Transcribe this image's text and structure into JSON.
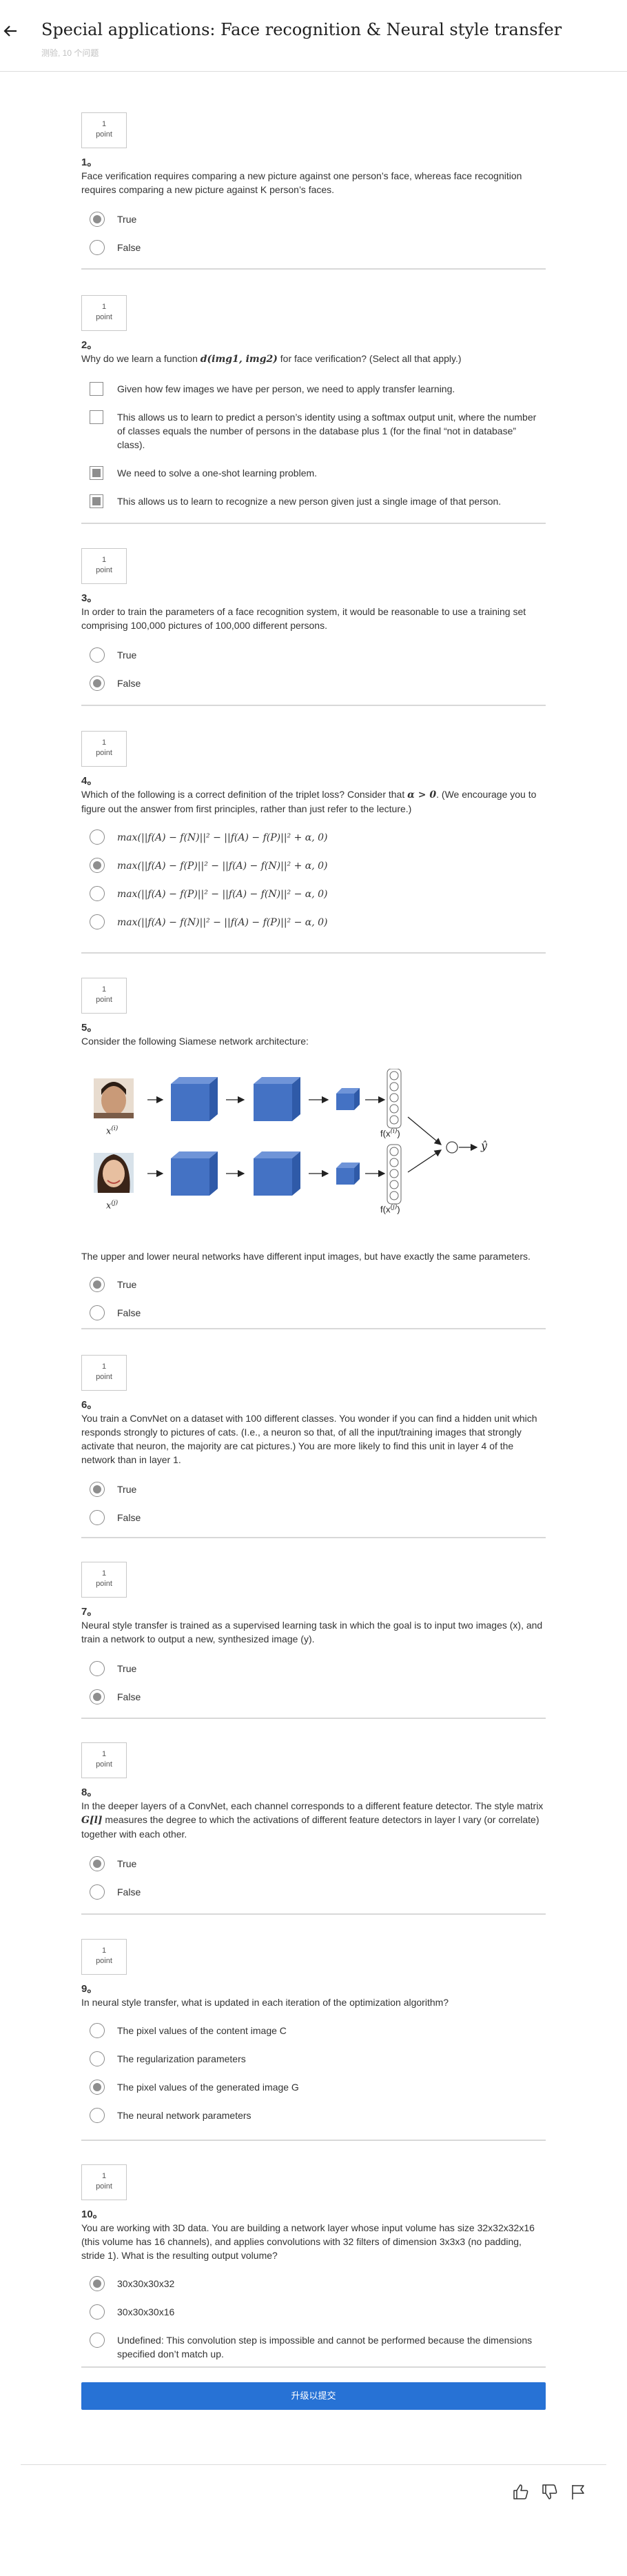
{
  "header": {
    "title": "Special applications: Face recognition & Neural style transfer",
    "subtitle": "测验, 10 个问题"
  },
  "point_label": "point",
  "point_value": "1",
  "questions": [
    {
      "num": "1。",
      "text": "Face verification requires comparing a new picture against one person’s face, whereas face recognition requires comparing a new picture against K person’s faces.",
      "options": [
        {
          "label": "True",
          "selected": true
        },
        {
          "label": "False",
          "selected": false
        }
      ]
    },
    {
      "num": "2。",
      "text_before": "Why do we learn a function ",
      "text_math": "d(img1, img2)",
      "text_after": " for face verification? (Select all that apply.)",
      "options": [
        {
          "label": "Given how few images we have per person, we need to apply transfer learning.",
          "selected": false
        },
        {
          "label": "This allows us to learn to predict a person’s identity using a softmax output unit, where the number of classes equals the number of persons in the database plus 1 (for the final “not in database” class).",
          "selected": false
        },
        {
          "label": "We need to solve a one-shot learning problem.",
          "selected": true
        },
        {
          "label": "This allows us to learn to recognize a new person given just a single image of that person.",
          "selected": true
        }
      ]
    },
    {
      "num": "3。",
      "text": "In order to train the parameters of a face recognition system, it would be reasonable to use a training set comprising 100,000 pictures of 100,000 different persons.",
      "options": [
        {
          "label": "True",
          "selected": false
        },
        {
          "label": "False",
          "selected": true
        }
      ]
    },
    {
      "num": "4。",
      "text_before": "Which of the following is a correct definition of the triplet loss? Consider that ",
      "text_math": "α > 0",
      "text_after": ". (We encourage you to figure out the answer from first principles, rather than just refer to the lecture.)",
      "options": [
        {
          "label": "max(||f(A) − f(N)||² − ||f(A) − f(P)||² + α, 0)",
          "selected": false
        },
        {
          "label": "max(||f(A) − f(P)||² − ||f(A) − f(N)||² + α, 0)",
          "selected": true
        },
        {
          "label": "max(||f(A) − f(P)||² − ||f(A) − f(N)||² − α, 0)",
          "selected": false
        },
        {
          "label": "max(||f(A) − f(N)||² − ||f(A) − f(P)||² − α, 0)",
          "selected": false
        }
      ]
    },
    {
      "num": "5。",
      "text": "Consider the following Siamese network architecture:",
      "figure": {
        "x_top": "x",
        "x_top_sup": "(i)",
        "x_bottom": "x",
        "x_bottom_sup": "(j)",
        "f_top": "f(x",
        "f_top_sup": "(i)",
        "f_bottom": "f(x",
        "f_bottom_sup": "(j)",
        "y_hat": "ŷ",
        "cube_color": "#4472c4"
      },
      "text2": "The upper and lower neural networks have different input images, but have exactly the same parameters.",
      "options": [
        {
          "label": "True",
          "selected": true
        },
        {
          "label": "False",
          "selected": false
        }
      ]
    },
    {
      "num": "6。",
      "text": "You train a ConvNet on a dataset with 100 different classes. You wonder if you can find a hidden unit which responds strongly to pictures of cats. (I.e., a neuron so that, of all the input/training images that strongly activate that neuron, the majority are cat pictures.) You are more likely to find this unit in layer 4 of the network than in layer 1.",
      "options": [
        {
          "label": "True",
          "selected": true
        },
        {
          "label": "False",
          "selected": false
        }
      ]
    },
    {
      "num": "7。",
      "text": "Neural style transfer is trained as a supervised learning task in which the goal is to input two images (x), and train a network to output a new, synthesized image (y).",
      "options": [
        {
          "label": "True",
          "selected": false
        },
        {
          "label": "False",
          "selected": true
        }
      ]
    },
    {
      "num": "8。",
      "text_before": "In the deeper layers of a ConvNet, each channel corresponds to a different feature detector. The style matrix ",
      "text_math": "G[l]",
      "text_after": " measures the degree to which the activations of different feature detectors in layer l vary (or correlate) together with each other.",
      "options": [
        {
          "label": "True",
          "selected": true
        },
        {
          "label": "False",
          "selected": false
        }
      ]
    },
    {
      "num": "9。",
      "text": "In neural style transfer, what is updated in each iteration of the optimization algorithm?",
      "options": [
        {
          "label": "The pixel values of the content image C",
          "selected": false
        },
        {
          "label": "The regularization parameters",
          "selected": false
        },
        {
          "label": "The pixel values of the generated image G",
          "selected": true
        },
        {
          "label": "The neural network parameters",
          "selected": false
        }
      ]
    },
    {
      "num": "10。",
      "text": "You are working with 3D data. You are building a network layer whose input volume has size 32x32x32x16 (this volume has 16 channels), and applies convolutions with 32 filters of dimension 3x3x3 (no padding, stride 1). What is the resulting output volume?",
      "options": [
        {
          "label": "30x30x30x32",
          "selected": true
        },
        {
          "label": "30x30x30x16",
          "selected": false
        },
        {
          "label": "Undefined: This convolution step is impossible and cannot be performed because the dimensions specified don’t match up.",
          "selected": false
        }
      ]
    }
  ],
  "submit_label": "升级以提交",
  "feedback": {
    "like": "thumbs-up-icon",
    "dislike": "thumbs-down-icon",
    "flag": "flag-icon"
  }
}
